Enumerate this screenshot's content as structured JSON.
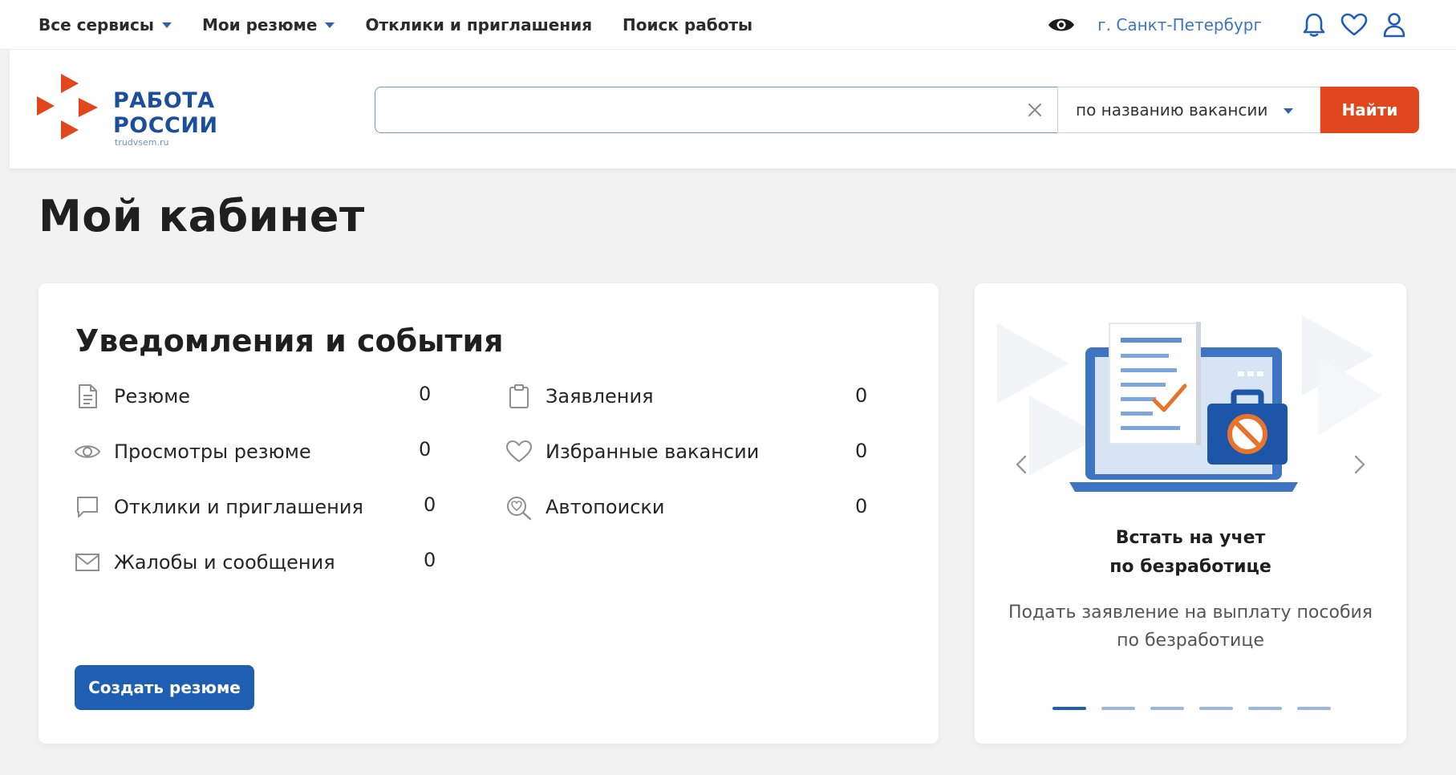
{
  "topnav": {
    "items": [
      {
        "label": "Все сервисы",
        "dropdown": true
      },
      {
        "label": "Мои резюме",
        "dropdown": true
      },
      {
        "label": "Отклики и приглашения",
        "dropdown": false
      },
      {
        "label": "Поиск работы",
        "dropdown": false
      }
    ],
    "city": "г. Санкт-Петербург"
  },
  "logo": {
    "line1": "РАБОТА",
    "line2": "РОССИИ",
    "domain": "trudvsem.ru"
  },
  "search": {
    "value": "",
    "placeholder": "",
    "type_label": "по названию вакансии",
    "button_label": "Найти"
  },
  "page": {
    "title": "Мой кабинет"
  },
  "notifications": {
    "heading": "Уведомления и события",
    "left": [
      {
        "label": "Резюме",
        "count": "0",
        "icon": "document-icon"
      },
      {
        "label": "Просмотры резюме",
        "count": "0",
        "icon": "eye-icon"
      },
      {
        "label": "Отклики и приглашения",
        "count": "0",
        "icon": "chat-icon"
      },
      {
        "label": "Жалобы и сообщения",
        "count": "0",
        "icon": "mail-icon"
      }
    ],
    "right": [
      {
        "label": "Заявления",
        "count": "0",
        "icon": "clipboard-icon"
      },
      {
        "label": "Избранные вакансии",
        "count": "0",
        "icon": "heart-icon"
      },
      {
        "label": "Автопоиски",
        "count": "0",
        "icon": "autosearch-icon"
      }
    ],
    "create_button": "Создать резюме"
  },
  "promo": {
    "title_line1": "Встать на учет",
    "title_line2": "по безработице",
    "desc_line1": "Подать заявление на выплату пособия",
    "desc_line2": "по безработице",
    "slides": 6,
    "active_slide": 1
  },
  "colors": {
    "brand_blue": "#1e5fb3",
    "link_blue": "#3d75c0",
    "accent_orange": "#e1471c",
    "page_bg": "#f2f2f2"
  }
}
